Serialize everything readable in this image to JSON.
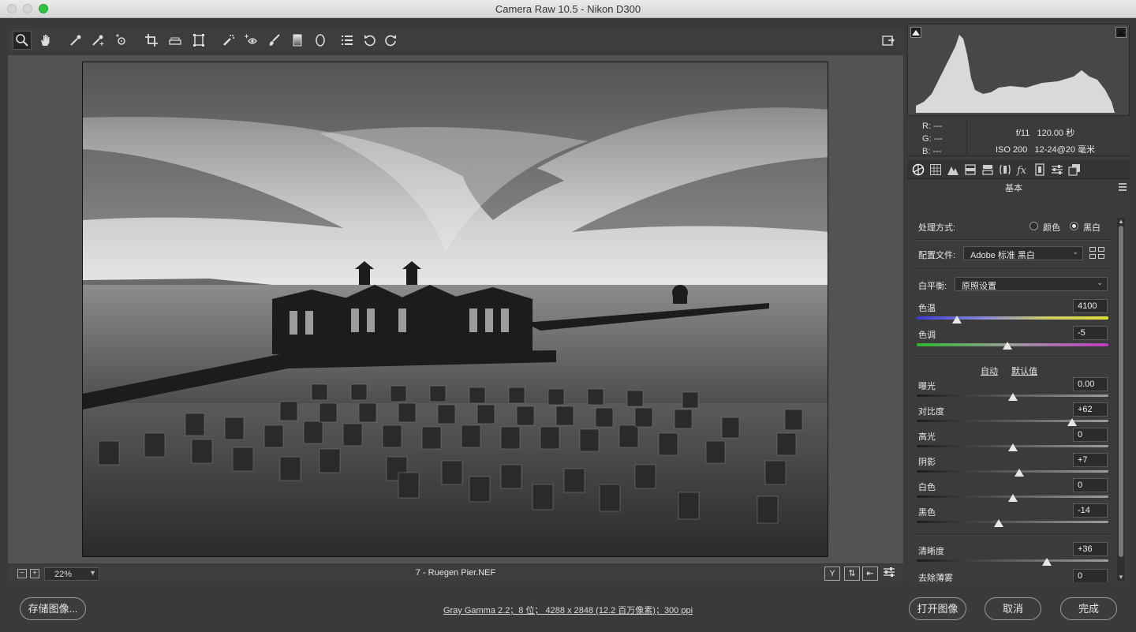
{
  "window": {
    "title": "Camera Raw 10.5 -  Nikon D300"
  },
  "toolbar": {
    "tools": [
      "zoom-icon",
      "hand-icon",
      "white-balance-icon",
      "color-sampler-icon",
      "target-adjustment-icon",
      "crop-icon",
      "straighten-icon",
      "transform-icon",
      "spot-removal-icon",
      "red-eye-icon",
      "adjustment-brush-icon",
      "graduated-filter-icon",
      "radial-filter-icon",
      "presets-list-icon",
      "rotate-left-icon",
      "rotate-right-icon"
    ],
    "active_tool": "zoom-icon"
  },
  "zoom": {
    "minus": "−",
    "plus": "+",
    "value": "22%"
  },
  "filename": "7 - Ruegen Pier.NEF",
  "view_buttons": {
    "y_label": "Y"
  },
  "bottom": {
    "save_label": "存储图像...",
    "workflow": "Gray Gamma 2.2；8 位；  4288 x 2848 (12.2 百万像素)；300 ppi",
    "open_label": "打开图像",
    "cancel_label": "取消",
    "done_label": "完成"
  },
  "readout": {
    "r_label": "R:",
    "r_value": "---",
    "g_label": "G:",
    "g_value": "---",
    "b_label": "B:",
    "b_value": "---",
    "aperture": "f/11",
    "shutter": "120.00 秒",
    "iso": "ISO 200",
    "lens": "12-24@20 毫米"
  },
  "panel": {
    "title": "基本",
    "treatment_label": "处理方式:",
    "treatment_color": "颜色",
    "treatment_bw": "黑白",
    "treatment_selected": "黑白",
    "profile_label": "配置文件:",
    "profile_value": "Adobe 标准 黑白",
    "wb_label": "白平衡:",
    "wb_value": "原照设置",
    "auto_label": "自动",
    "default_label": "默认值",
    "sliders": {
      "temp": {
        "label": "色温",
        "value": "4100",
        "position": 0.21
      },
      "tint": {
        "label": "色调",
        "value": "-5",
        "position": 0.475
      },
      "exposure": {
        "label": "曝光",
        "value": "0.00",
        "position": 0.5
      },
      "contrast": {
        "label": "对比度",
        "value": "+62",
        "position": 0.81
      },
      "highlights": {
        "label": "高光",
        "value": "0",
        "position": 0.5
      },
      "shadows": {
        "label": "阴影",
        "value": "+7",
        "position": 0.535
      },
      "whites": {
        "label": "白色",
        "value": "0",
        "position": 0.5
      },
      "blacks": {
        "label": "黑色",
        "value": "-14",
        "position": 0.43
      },
      "clarity": {
        "label": "清晰度",
        "value": "+36",
        "position": 0.68
      },
      "dehaze": {
        "label": "去除薄雾",
        "value": "0",
        "position": 0.5
      }
    }
  },
  "colors": {
    "accent_green": "#2ec440",
    "panel_bg": "#3b3b3b"
  }
}
